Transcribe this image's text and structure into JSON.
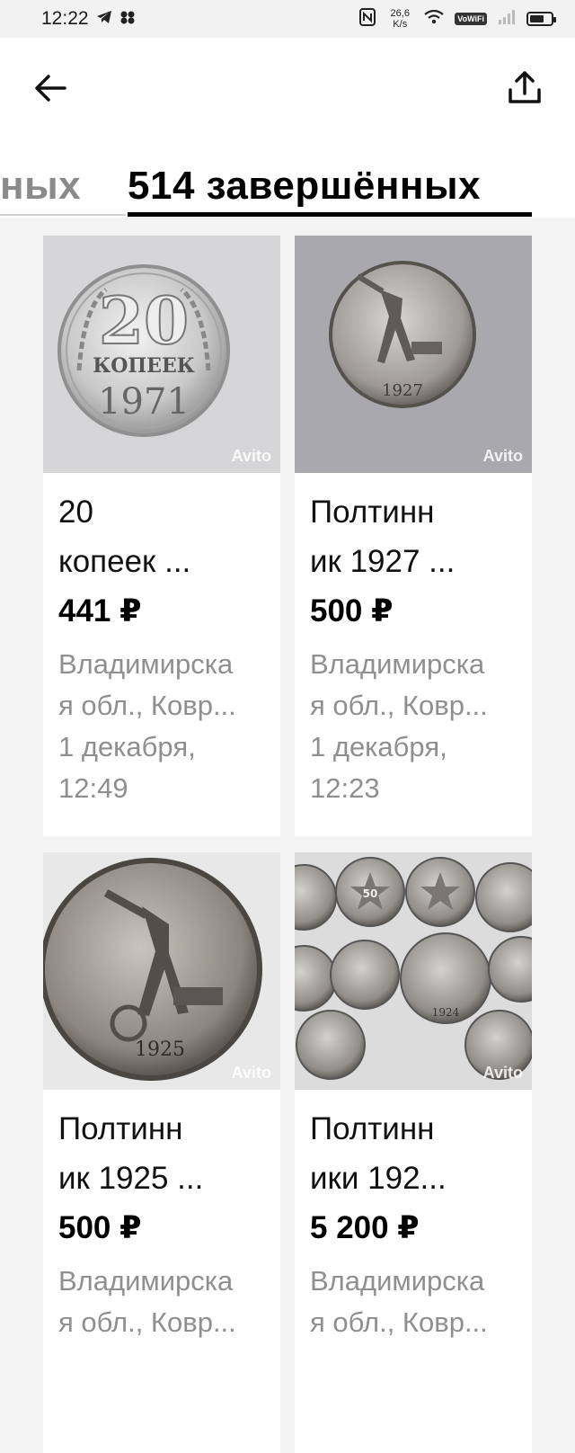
{
  "status": {
    "time": "12:22",
    "netspeed": "26,6 K/s",
    "vowifi": "VoWiFi",
    "battery_level": 0.7
  },
  "header": {
    "back_icon": "arrow-left-icon",
    "share_icon": "share-icon"
  },
  "tabs": {
    "partial_label": "ных",
    "active_label": "514 завершённых"
  },
  "items": [
    {
      "title_l1": "20",
      "title_l2": "копеек ...",
      "price": "441 ₽",
      "loc_l1": "Владимирска",
      "loc_l2": "я обл., Ковр...",
      "date_l1": "1 декабря,",
      "date_l2": "12:49",
      "watermark": "Avito"
    },
    {
      "title_l1": "Полтинн",
      "title_l2": "ик 1927 ...",
      "price": "500 ₽",
      "loc_l1": "Владимирска",
      "loc_l2": "я обл., Ковр...",
      "date_l1": "1 декабря,",
      "date_l2": "12:23",
      "watermark": "Avito"
    },
    {
      "title_l1": "Полтинн",
      "title_l2": "ик 1925 ...",
      "price": "500 ₽",
      "loc_l1": "Владимирска",
      "loc_l2": "я обл., Ковр...",
      "date_l1": "",
      "date_l2": "",
      "watermark": "Avito"
    },
    {
      "title_l1": "Полтинн",
      "title_l2": "ики 192...",
      "price": "5 200 ₽",
      "loc_l1": "Владимирска",
      "loc_l2": "я обл., Ковр...",
      "date_l1": "",
      "date_l2": "",
      "watermark": "Avito"
    }
  ],
  "coin_texts": {
    "c1_value": "20",
    "c1_word": "КОПЕЕК",
    "c1_year": "1971",
    "c2_year": "1927",
    "c3_year": "1925",
    "c4_year": "1924",
    "c4_value": "50"
  }
}
